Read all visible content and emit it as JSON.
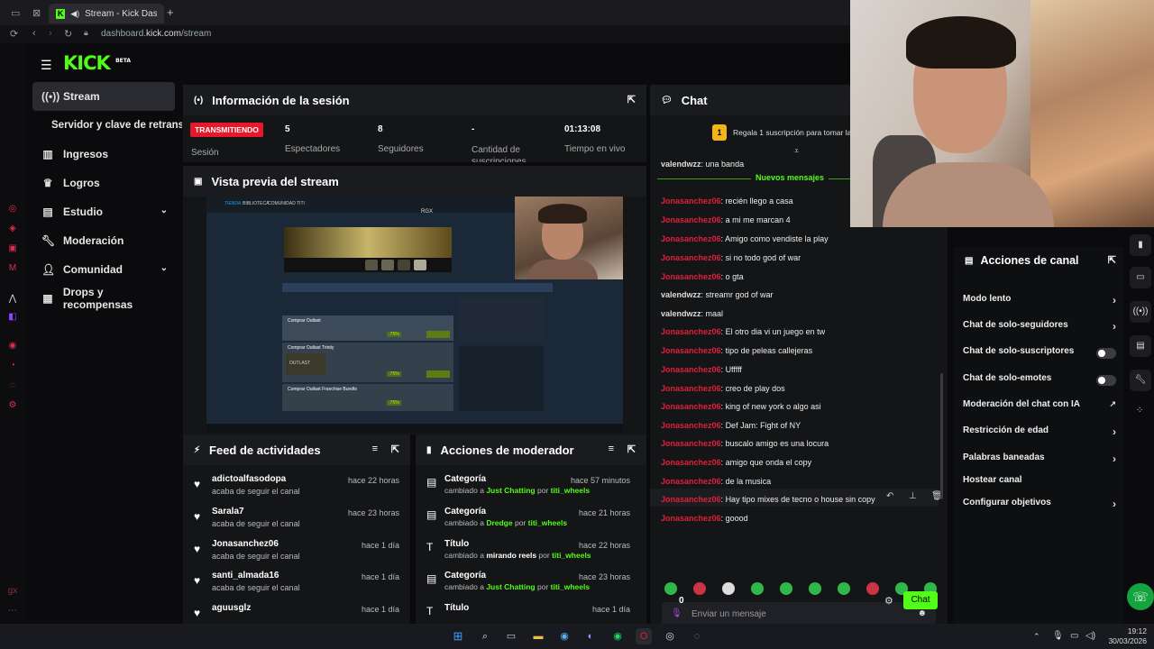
{
  "browser": {
    "tab_title": "Stream - Kick Dashboard",
    "new_tab": "+",
    "url_domain": "dashboard.",
    "url_host": "kick.com",
    "url_path": "/stream"
  },
  "sidebar": {
    "logo": "KICK",
    "logo_badge": "BETA",
    "items": [
      {
        "label": "Stream",
        "icon": "broadcast-icon",
        "active": true
      },
      {
        "label": "Servidor y clave de retransn"
      },
      {
        "label": "Ingresos",
        "icon": "bar-chart-icon"
      },
      {
        "label": "Logros",
        "icon": "trophy-icon"
      },
      {
        "label": "Estudio",
        "icon": "studio-icon",
        "expandable": true
      },
      {
        "label": "Moderación",
        "icon": "wrench-icon"
      },
      {
        "label": "Comunidad",
        "icon": "people-icon",
        "expandable": true
      },
      {
        "label": "Drops y recompensas",
        "icon": "gift-icon"
      }
    ]
  },
  "session": {
    "title": "Información de la sesión",
    "status_badge": "TRANSMITIENDO",
    "status_label": "Sesión",
    "stats": [
      {
        "value": "5",
        "label": "Espectadores"
      },
      {
        "value": "8",
        "label": "Seguidores"
      },
      {
        "value": "-",
        "label": "Cantidad de suscripciones"
      },
      {
        "value": "01:13:08",
        "label": "Tiempo en vivo"
      }
    ]
  },
  "preview": {
    "title": "Vista previa del stream",
    "store_tabs": [
      "TIENDA",
      "BIBLIOTECA",
      "COMUNIDAD",
      "TITI"
    ],
    "store_user": "RGX",
    "sale_rows": [
      {
        "title": "Comprar Outlast",
        "discount": "-75%"
      },
      {
        "title": "Comprar Outlast Trinity",
        "discount": "-75%"
      },
      {
        "title": "Comprar Outlast Franchise Bundle",
        "discount": "-75%"
      }
    ],
    "game_art_label": "OUTLAST"
  },
  "activity_feed": {
    "title": "Feed de actividades",
    "items": [
      {
        "name": "adictoalfasodopa",
        "sub": "acaba de seguir el canal",
        "time": "hace 22 horas"
      },
      {
        "name": "Sarala7",
        "sub": "acaba de seguir el canal",
        "time": "hace 23 horas"
      },
      {
        "name": "Jonasanchez06",
        "sub": "acaba de seguir el canal",
        "time": "hace 1 día"
      },
      {
        "name": "santi_almada16",
        "sub": "acaba de seguir el canal",
        "time": "hace 1 día"
      },
      {
        "name": "aguusglz",
        "sub": "",
        "time": "hace 1 día"
      }
    ]
  },
  "mod_actions": {
    "title": "Acciones de moderador",
    "items": [
      {
        "name": "Categoría",
        "pre": "cambiado a ",
        "target": "Just Chatting",
        "by": " por ",
        "user": "titi_wheels",
        "time": "hace 57 minutos",
        "target_green": true
      },
      {
        "name": "Categoría",
        "pre": "cambiado a ",
        "target": "Dredge",
        "by": " por ",
        "user": "titi_wheels",
        "time": "hace 21 horas",
        "target_green": true
      },
      {
        "name": "Título",
        "pre": "cambiado a ",
        "target": "mirando reels",
        "by": " por ",
        "user": "titi_wheels",
        "time": "hace 22 horas",
        "target_green": false
      },
      {
        "name": "Categoría",
        "pre": "cambiado a ",
        "target": "Just Chatting",
        "by": " por ",
        "user": "titi_wheels",
        "time": "hace 23 horas",
        "target_green": true
      },
      {
        "name": "Título",
        "pre": "",
        "target": "",
        "by": "",
        "user": "",
        "time": "hace 1 día",
        "target_green": false
      }
    ]
  },
  "chat": {
    "title": "Chat",
    "pinned": "Regala 1 suscripción para tomar la",
    "pinned_badge": "1",
    "new_messages": "Nuevos mensajes",
    "messages": [
      {
        "user": "valendwzz",
        "text": "una banda",
        "color": "white"
      },
      {
        "user": "Jonasanchez06",
        "text": "recién llego a casa",
        "color": "red"
      },
      {
        "user": "Jonasanchez06",
        "text": "a mi me marcan 4",
        "color": "red"
      },
      {
        "user": "Jonasanchez06",
        "text": "Amigo como vendiste la play",
        "color": "red"
      },
      {
        "user": "Jonasanchez06",
        "text": "si no todo god of war",
        "color": "red"
      },
      {
        "user": "Jonasanchez06",
        "text": "o gta",
        "color": "red"
      },
      {
        "user": "valendwzz",
        "text": "streamr god of war",
        "color": "white"
      },
      {
        "user": "valendwzz",
        "text": "maal",
        "color": "white"
      },
      {
        "user": "Jonasanchez06",
        "text": "El otro dia vi un juego en tw",
        "color": "red"
      },
      {
        "user": "Jonasanchez06",
        "text": "tipo de peleas callejeras",
        "color": "red"
      },
      {
        "user": "Jonasanchez06",
        "text": "Ufffff",
        "color": "red"
      },
      {
        "user": "Jonasanchez06",
        "text": "creo de play dos",
        "color": "red"
      },
      {
        "user": "Jonasanchez06",
        "text": "king of new york o algo asi",
        "color": "red"
      },
      {
        "user": "Jonasanchez06",
        "text": "Def Jam: Fight of NY",
        "color": "red"
      },
      {
        "user": "Jonasanchez06",
        "text": "buscalo amigo es una locura",
        "color": "red"
      },
      {
        "user": "Jonasanchez06",
        "text": "amigo que onda el copy",
        "color": "red"
      },
      {
        "user": "Jonasanchez06",
        "text": "de la musica",
        "color": "red"
      },
      {
        "user": "Jonasanchez06",
        "text": "Hay tipo mixes de tecno o house sin copy",
        "color": "red"
      },
      {
        "user": "Jonasanchez06",
        "text": "goood",
        "color": "red"
      }
    ],
    "input_placeholder": "Enviar un mensaje",
    "points": "0",
    "send_label": "Chat"
  },
  "channel_actions": {
    "title": "Acciones de canal",
    "items": [
      {
        "label": "Modo lento",
        "control": "chevron"
      },
      {
        "label": "Chat de solo-seguidores",
        "control": "chevron"
      },
      {
        "label": "Chat de solo-suscriptores",
        "control": "toggle"
      },
      {
        "label": "Chat de solo-emotes",
        "control": "toggle"
      },
      {
        "label": "Moderación del chat con IA",
        "control": "external"
      },
      {
        "label": "Restricción de edad",
        "control": "chevron"
      },
      {
        "label": "Palabras baneadas",
        "control": "chevron"
      },
      {
        "label": "Hostear canal",
        "control": "none"
      },
      {
        "label": "Configurar objetivos",
        "control": "chevron"
      }
    ]
  },
  "taskbar": {
    "time": "19:12",
    "date": "30/03/2026"
  },
  "colors": {
    "accent": "#53fc18",
    "live_badge": "#e8182c",
    "username_red": "#e0203a",
    "pinned_badge": "#f0b51a"
  }
}
